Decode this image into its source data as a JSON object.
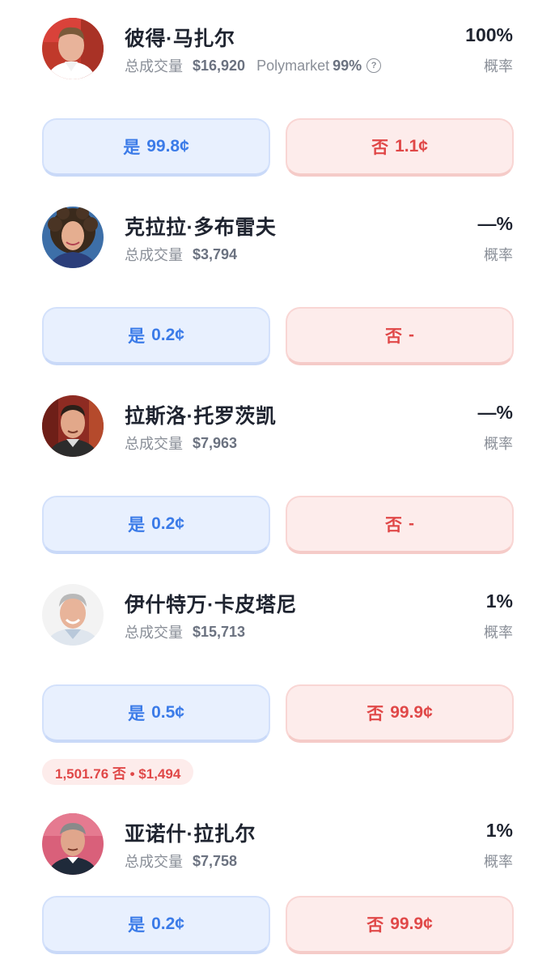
{
  "markets": [
    {
      "name": "彼得·马扎尔",
      "volume_label": "总成交量",
      "volume": "$16,920",
      "source": "Polymarket",
      "source_pct": "99%",
      "probability": "100%",
      "probability_label": "概率",
      "yes_label": "是",
      "yes_price": "99.8¢",
      "no_label": "否",
      "no_price": "1.1¢",
      "avatar_icon": "person-photo"
    },
    {
      "name": "克拉拉·多布雷夫",
      "volume_label": "总成交量",
      "volume": "$3,794",
      "probability": "—%",
      "probability_label": "概率",
      "yes_label": "是",
      "yes_price": "0.2¢",
      "no_label": "否",
      "no_price": "-",
      "avatar_icon": "person-photo"
    },
    {
      "name": "拉斯洛·托罗茨凯",
      "volume_label": "总成交量",
      "volume": "$7,963",
      "probability": "—%",
      "probability_label": "概率",
      "yes_label": "是",
      "yes_price": "0.2¢",
      "no_label": "否",
      "no_price": "-",
      "avatar_icon": "person-photo"
    },
    {
      "name": "伊什特万·卡皮塔尼",
      "volume_label": "总成交量",
      "volume": "$15,713",
      "probability": "1%",
      "probability_label": "概率",
      "yes_label": "是",
      "yes_price": "0.5¢",
      "no_label": "否",
      "no_price": "99.9¢",
      "position": "1,501.76 否 • $1,494",
      "avatar_icon": "person-photo"
    },
    {
      "name": "亚诺什·拉扎尔",
      "volume_label": "总成交量",
      "volume": "$7,758",
      "probability": "1%",
      "probability_label": "概率",
      "yes_label": "是",
      "yes_price": "0.2¢",
      "no_label": "否",
      "no_price": "99.9¢",
      "avatar_icon": "person-photo"
    }
  ],
  "colors": {
    "yes_bg": "#e8f0fe",
    "yes_text": "#3b7be8",
    "no_bg": "#fdeceb",
    "no_text": "#e04848"
  }
}
